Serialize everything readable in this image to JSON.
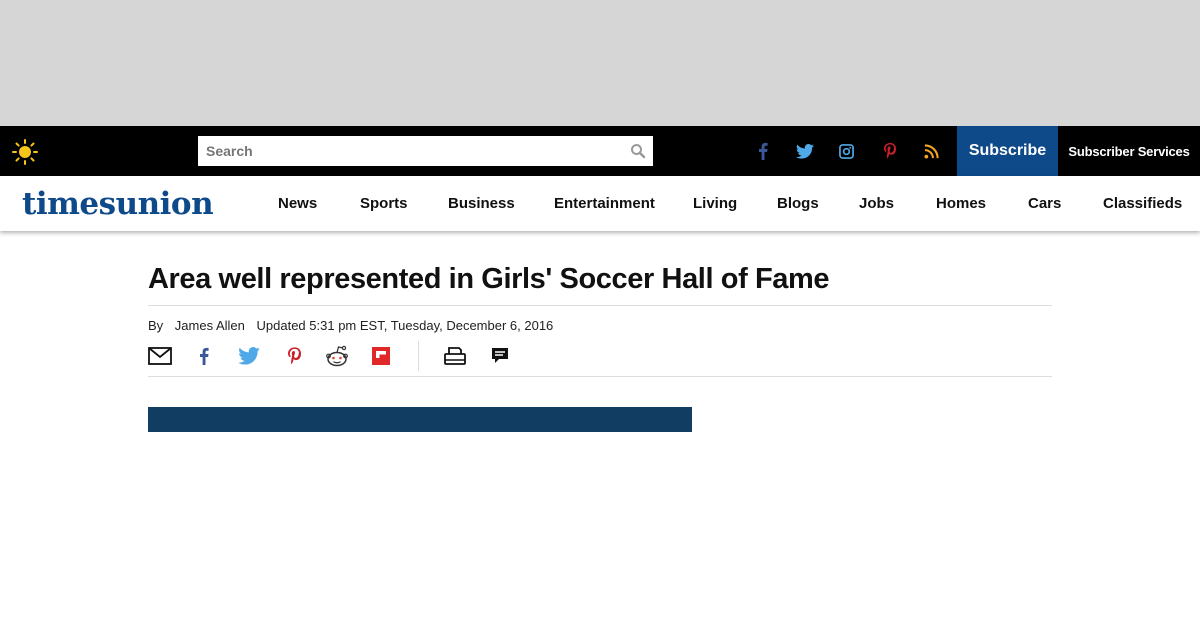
{
  "colors": {
    "ad_banner": "#d6d6d6",
    "topbar": "#000000",
    "brand_blue": "#0e4a8a",
    "media_bar": "#123d62",
    "facebook": "#3b5998",
    "twitter": "#4fa9e8",
    "instagram": "#4fa9e8",
    "pinterest": "#cb2027",
    "rss": "#f5a623",
    "flipboard": "#e12828"
  },
  "topbar": {
    "weather_icon": "sun-icon",
    "search": {
      "placeholder": "Search",
      "value": "",
      "icon": "search-icon"
    },
    "social": [
      "facebook-icon",
      "twitter-icon",
      "instagram-icon",
      "pinterest-icon",
      "rss-icon"
    ],
    "subscribe_label": "Subscribe",
    "subscriber_services_label": "Subscriber Services"
  },
  "navbar": {
    "logo": "timesunion",
    "items": [
      "News",
      "Sports",
      "Business",
      "Entertainment",
      "Living",
      "Blogs",
      "Jobs",
      "Homes",
      "Cars",
      "Classifieds"
    ]
  },
  "article": {
    "headline": "Area well represented in Girls' Soccer Hall of Fame",
    "byline_prefix": "By",
    "author": "James Allen",
    "updated": "Updated 5:31 pm EST, Tuesday, December 6, 2016",
    "share_icons": [
      "email-icon",
      "facebook-icon",
      "twitter-icon",
      "pinterest-icon",
      "reddit-icon",
      "flipboard-icon"
    ],
    "tool_icons": [
      "print-icon",
      "comment-icon"
    ]
  }
}
